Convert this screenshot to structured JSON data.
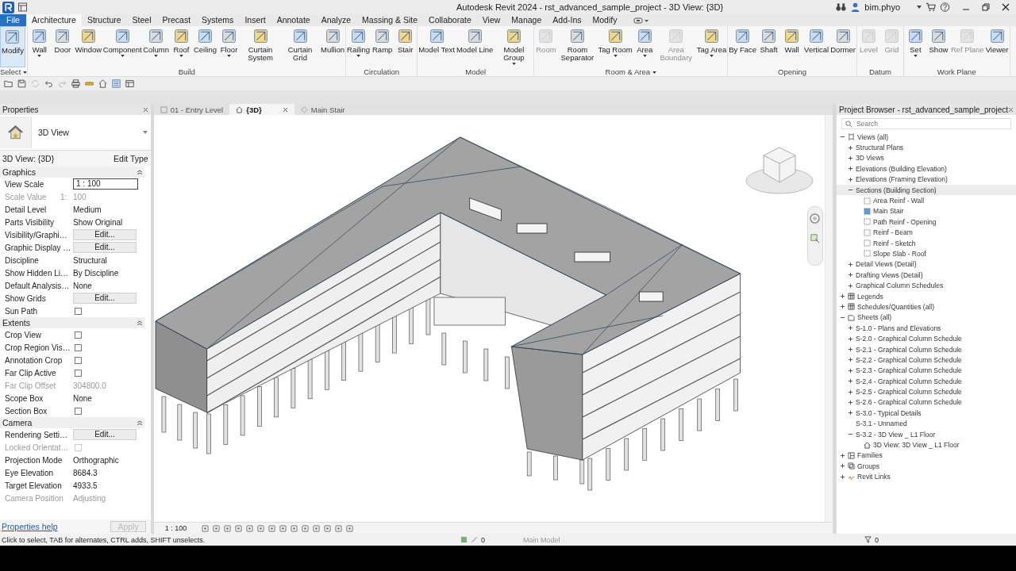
{
  "window": {
    "title": "Autodesk Revit 2024 - rst_advanced_sample_project - 3D View: {3D}",
    "user": "bim.phyo"
  },
  "ribbon_tabs": [
    {
      "label": "File",
      "kind": "file",
      "selected": false
    },
    {
      "label": "Architecture",
      "kind": "tab",
      "selected": true
    },
    {
      "label": "Structure",
      "kind": "tab",
      "selected": false
    },
    {
      "label": "Steel",
      "kind": "tab",
      "selected": false
    },
    {
      "label": "Precast",
      "kind": "tab",
      "selected": false
    },
    {
      "label": "Systems",
      "kind": "tab",
      "selected": false
    },
    {
      "label": "Insert",
      "kind": "tab",
      "selected": false
    },
    {
      "label": "Annotate",
      "kind": "tab",
      "selected": false
    },
    {
      "label": "Analyze",
      "kind": "tab",
      "selected": false
    },
    {
      "label": "Massing & Site",
      "kind": "tab",
      "selected": false
    },
    {
      "label": "Collaborate",
      "kind": "tab",
      "selected": false
    },
    {
      "label": "View",
      "kind": "tab",
      "selected": false
    },
    {
      "label": "Manage",
      "kind": "tab",
      "selected": false
    },
    {
      "label": "Add-Ins",
      "kind": "tab",
      "selected": false
    },
    {
      "label": "Modify",
      "kind": "tab",
      "selected": false
    }
  ],
  "ribbon_panels": [
    {
      "title": "Select",
      "dropdown": true,
      "buttons": [
        {
          "label": "Modify",
          "disabled": false,
          "dropdown": false,
          "selected": true
        }
      ]
    },
    {
      "title": "Build",
      "dropdown": false,
      "buttons": [
        {
          "label": "Wall",
          "disabled": false,
          "dropdown": true,
          "selected": false
        },
        {
          "label": "Door",
          "disabled": false,
          "dropdown": false,
          "selected": false
        },
        {
          "label": "Window",
          "disabled": false,
          "dropdown": false,
          "selected": false
        },
        {
          "label": "Component",
          "disabled": false,
          "dropdown": true,
          "selected": false
        },
        {
          "label": "Column",
          "disabled": false,
          "dropdown": true,
          "selected": false
        },
        {
          "label": "Roof",
          "disabled": false,
          "dropdown": true,
          "selected": false
        },
        {
          "label": "Ceiling",
          "disabled": false,
          "dropdown": false,
          "selected": false
        },
        {
          "label": "Floor",
          "disabled": false,
          "dropdown": true,
          "selected": false
        },
        {
          "label": "Curtain System",
          "disabled": false,
          "dropdown": false,
          "selected": false
        },
        {
          "label": "Curtain Grid",
          "disabled": false,
          "dropdown": false,
          "selected": false
        },
        {
          "label": "Mullion",
          "disabled": false,
          "dropdown": false,
          "selected": false
        }
      ]
    },
    {
      "title": "Circulation",
      "dropdown": false,
      "buttons": [
        {
          "label": "Railing",
          "disabled": false,
          "dropdown": true,
          "selected": false
        },
        {
          "label": "Ramp",
          "disabled": false,
          "dropdown": false,
          "selected": false
        },
        {
          "label": "Stair",
          "disabled": false,
          "dropdown": false,
          "selected": false
        }
      ]
    },
    {
      "title": "Model",
      "dropdown": false,
      "buttons": [
        {
          "label": "Model Text",
          "disabled": false,
          "dropdown": false,
          "selected": false
        },
        {
          "label": "Model Line",
          "disabled": false,
          "dropdown": false,
          "selected": false
        },
        {
          "label": "Model Group",
          "disabled": false,
          "dropdown": true,
          "selected": false
        }
      ]
    },
    {
      "title": "Room & Area",
      "dropdown": true,
      "buttons": [
        {
          "label": "Room",
          "disabled": true,
          "dropdown": false,
          "selected": false
        },
        {
          "label": "Room Separator",
          "disabled": false,
          "dropdown": false,
          "selected": false
        },
        {
          "label": "Tag Room",
          "disabled": false,
          "dropdown": true,
          "selected": false
        },
        {
          "label": "Area",
          "disabled": false,
          "dropdown": true,
          "selected": false
        },
        {
          "label": "Area Boundary",
          "disabled": true,
          "dropdown": false,
          "selected": false
        },
        {
          "label": "Tag Area",
          "disabled": false,
          "dropdown": true,
          "selected": false
        }
      ]
    },
    {
      "title": "Opening",
      "dropdown": false,
      "buttons": [
        {
          "label": "By Face",
          "disabled": false,
          "dropdown": false,
          "selected": false
        },
        {
          "label": "Shaft",
          "disabled": false,
          "dropdown": false,
          "selected": false
        },
        {
          "label": "Wall",
          "disabled": false,
          "dropdown": false,
          "selected": false
        },
        {
          "label": "Vertical",
          "disabled": false,
          "dropdown": false,
          "selected": false
        },
        {
          "label": "Dormer",
          "disabled": false,
          "dropdown": false,
          "selected": false
        }
      ]
    },
    {
      "title": "Datum",
      "dropdown": false,
      "buttons": [
        {
          "label": "Level",
          "disabled": true,
          "dropdown": false,
          "selected": false
        },
        {
          "label": "Grid",
          "disabled": true,
          "dropdown": false,
          "selected": false
        }
      ]
    },
    {
      "title": "Work Plane",
      "dropdown": false,
      "buttons": [
        {
          "label": "Set",
          "disabled": false,
          "dropdown": true,
          "selected": false
        },
        {
          "label": "Show",
          "disabled": false,
          "dropdown": false,
          "selected": false
        },
        {
          "label": "Ref Plane",
          "disabled": true,
          "dropdown": false,
          "selected": false
        },
        {
          "label": "Viewer",
          "disabled": false,
          "dropdown": false,
          "selected": false
        }
      ]
    }
  ],
  "properties": {
    "title": "Properties",
    "type_name": "3D View",
    "instance": "3D View: {3D}",
    "edit_type": "Edit Type",
    "groups": [
      {
        "name": "Graphics",
        "rows": [
          {
            "label": "View Scale",
            "kind": "input",
            "value": "1 : 100",
            "disabled": false
          },
          {
            "label": "Scale Value",
            "kind": "text",
            "prefix": "1:",
            "value": "100",
            "disabled": true
          },
          {
            "label": "Detail Level",
            "kind": "text",
            "value": "Medium",
            "disabled": false
          },
          {
            "label": "Parts Visibility",
            "kind": "text",
            "value": "Show Original",
            "disabled": false
          },
          {
            "label": "Visibility/Graphi…",
            "kind": "button",
            "value": "Edit...",
            "disabled": false
          },
          {
            "label": "Graphic Display …",
            "kind": "button",
            "value": "Edit...",
            "disabled": false
          },
          {
            "label": "Discipline",
            "kind": "text",
            "value": "Structural",
            "disabled": false
          },
          {
            "label": "Show Hidden Li…",
            "kind": "text",
            "value": "By Discipline",
            "disabled": false
          },
          {
            "label": "Default Analysis…",
            "kind": "text",
            "value": "None",
            "disabled": false
          },
          {
            "label": "Show Grids",
            "kind": "button",
            "value": "Edit...",
            "disabled": false
          },
          {
            "label": "Sun Path",
            "kind": "checkbox",
            "checked": false,
            "disabled": false
          }
        ]
      },
      {
        "name": "Extents",
        "rows": [
          {
            "label": "Crop View",
            "kind": "checkbox",
            "checked": false,
            "disabled": false
          },
          {
            "label": "Crop Region Vis…",
            "kind": "checkbox",
            "checked": false,
            "disabled": false
          },
          {
            "label": "Annotation Crop",
            "kind": "checkbox",
            "checked": false,
            "disabled": false
          },
          {
            "label": "Far Clip Active",
            "kind": "checkbox",
            "checked": false,
            "disabled": false
          },
          {
            "label": "Far Clip Offset",
            "kind": "text",
            "value": "304800.0",
            "disabled": true
          },
          {
            "label": "Scope Box",
            "kind": "text",
            "value": "None",
            "disabled": false
          },
          {
            "label": "Section Box",
            "kind": "checkbox",
            "checked": false,
            "disabled": false
          }
        ]
      },
      {
        "name": "Camera",
        "rows": [
          {
            "label": "Rendering Setti…",
            "kind": "button",
            "value": "Edit...",
            "disabled": false
          },
          {
            "label": "Locked Orientat…",
            "kind": "checkbox",
            "checked": false,
            "disabled": true
          },
          {
            "label": "Projection Mode",
            "kind": "text",
            "value": "Orthographic",
            "disabled": false
          },
          {
            "label": "Eye Elevation",
            "kind": "text",
            "value": "8684.3",
            "disabled": false
          },
          {
            "label": "Target Elevation",
            "kind": "text",
            "value": "4933.5",
            "disabled": false
          },
          {
            "label": "Camera Position",
            "kind": "text",
            "value": "Adjusting",
            "disabled": true
          }
        ]
      }
    ],
    "help_link": "Properties help",
    "apply": {
      "label": "Apply",
      "disabled": true
    }
  },
  "view_tabs": [
    {
      "label": "01 - Entry Level",
      "kind": "plan",
      "selected": false
    },
    {
      "label": "{3D}",
      "kind": "model",
      "selected": true
    },
    {
      "label": "Main Stair",
      "kind": "section",
      "selected": false
    }
  ],
  "view_scale": "1 : 100",
  "browser": {
    "title": "Project Browser - rst_advanced_sample_project",
    "search": {
      "placeholder": "Search"
    },
    "tree": [
      {
        "label": "Views (all)",
        "kind": "views",
        "expanded": true,
        "selected": false,
        "children": [
          {
            "label": "Structural Plans",
            "expanded": false,
            "selected": false
          },
          {
            "label": "3D Views",
            "expanded": false,
            "selected": false
          },
          {
            "label": "Elevations (Building Elevation)",
            "expanded": false,
            "selected": false
          },
          {
            "label": "Elevations (Framing Elevation)",
            "expanded": false,
            "selected": false
          },
          {
            "label": "Sections (Building Section)",
            "expanded": true,
            "selected": true,
            "children": [
              {
                "label": "Area Reinf - Wall",
                "kind": "section",
                "open": false,
                "selected": false
              },
              {
                "label": "Main Stair",
                "kind": "section",
                "open": true,
                "selected": false
              },
              {
                "label": "Path Reinf - Opening",
                "kind": "section",
                "open": false,
                "selected": false
              },
              {
                "label": "Reinf - Beam",
                "kind": "section",
                "open": false,
                "selected": false
              },
              {
                "label": "Reinf - Sketch",
                "kind": "section",
                "open": false,
                "selected": false
              },
              {
                "label": "Slope Slab - Roof",
                "kind": "section",
                "open": false,
                "selected": false
              }
            ]
          },
          {
            "label": "Detail Views (Detail)",
            "expanded": false,
            "selected": false
          },
          {
            "label": "Drafting Views (Detail)",
            "expanded": false,
            "selected": false
          },
          {
            "label": "Graphical Column Schedules",
            "expanded": false,
            "selected": false
          }
        ]
      },
      {
        "label": "Legends",
        "kind": "legends",
        "expanded": false,
        "selected": false
      },
      {
        "label": "Schedules/Quantities (all)",
        "kind": "schedules",
        "expanded": false,
        "selected": false
      },
      {
        "label": "Sheets (all)",
        "kind": "sheets",
        "expanded": true,
        "selected": false,
        "children": [
          {
            "label": "S-1.0 - Plans and Elevations",
            "expanded": false,
            "selected": false
          },
          {
            "label": "S-2.0 - Graphical Column Schedule",
            "expanded": false,
            "selected": false
          },
          {
            "label": "S-2.1 - Graphical Column Schedule",
            "expanded": false,
            "selected": false
          },
          {
            "label": "S-2.2 - Graphical Column Schedule",
            "expanded": false,
            "selected": false
          },
          {
            "label": "S-2.3 - Graphical Column Schedule",
            "expanded": false,
            "selected": false
          },
          {
            "label": "S-2.4 - Graphical Column Schedule",
            "expanded": false,
            "selected": false
          },
          {
            "label": "S-2.5 - Graphical Column Schedule",
            "expanded": false,
            "selected": false
          },
          {
            "label": "S-2.6 - Graphical Column Schedule",
            "expanded": false,
            "selected": false
          },
          {
            "label": "S-3.0 - Typical Details",
            "expanded": false,
            "selected": false
          },
          {
            "label": "S-3.1 - Unnamed",
            "selected": false
          },
          {
            "label": "S-3.2 - 3D View _ L1 Floor",
            "expanded": true,
            "selected": false,
            "children": [
              {
                "label": "3D View: 3D View _ L1 Floor",
                "kind": "view3d",
                "selected": false
              }
            ]
          }
        ]
      },
      {
        "label": "Families",
        "kind": "families",
        "expanded": false,
        "selected": false
      },
      {
        "label": "Groups",
        "kind": "groups",
        "expanded": false,
        "selected": false
      },
      {
        "label": "Revit Links",
        "kind": "links",
        "expanded": false,
        "selected": false
      }
    ]
  },
  "status_bar": {
    "message": "Click to select, TAB for alternates, CTRL adds, SHIFT unselects.",
    "editable_count": "0",
    "workset": "Main Model",
    "filter_count": "0"
  }
}
